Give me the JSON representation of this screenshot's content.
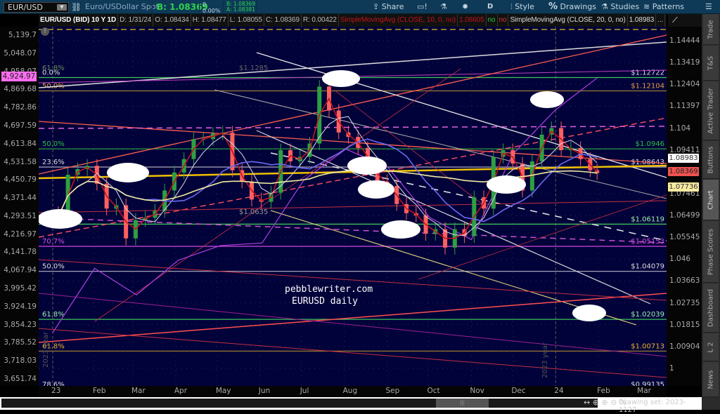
{
  "toolbar": {
    "symbol": "EUR/USD",
    "description": "Euro/USDollar Spot",
    "bid": "B: 1.08369",
    "change": "0",
    "change_pct": "0.00%",
    "bid_small": "B: 1.08369",
    "ask_small": "A: 1.08381",
    "share": "Share",
    "aggregation": "D",
    "style": "Style",
    "drawings": "Drawings",
    "studies": "Studies",
    "patterns": "Patterns"
  },
  "info": {
    "title": "EUR/USD (BID) 10 Y 1D",
    "date": "D: 1/31/24",
    "open": "O: 1.08434",
    "high": "H: 1.08477",
    "low": "L: 1.08055",
    "close": "C: 1.08369",
    "range": "R: 0.00422",
    "sma10": "SimpleMovingAvg (CLOSE, 10, 0, no)",
    "sma10_val": "1.08605",
    "no1": "no",
    "no2": "no",
    "sma20": "SimpleMovingAvg (CLOSE, 20, 0, no)",
    "sma20_val": "1.08983",
    "more": "..."
  },
  "side_tabs": [
    "Trade",
    "T&S",
    "Active Trader",
    "Buttons",
    "Chart",
    "Phase Scores",
    "Dashboard",
    "L 2",
    "News"
  ],
  "colors": {
    "bg": "#02023a",
    "up": "#2ea043",
    "down": "#ff5f5f",
    "sma10": "#c0141c",
    "sma20": "#d8d8e8",
    "sma50": "#6a6af0",
    "sma200": "#f0eaa0",
    "spx": "#b040e0"
  },
  "annotations": {
    "watermark": "pebblewriter.com",
    "subtitle": "EURUSD daily",
    "high_label": "$1.1285",
    "low_label": "$1.0635",
    "year_2023_a": "2023 year",
    "year_2023_b": "2023 year"
  },
  "price_tags": [
    {
      "value": "1.08983",
      "bg": "#ffffff",
      "fg": "#333"
    },
    {
      "value": "1.08369",
      "bg": "#ef5350",
      "fg": "#222"
    },
    {
      "value": "1.07736",
      "bg": "#f8eaa0",
      "fg": "#333"
    }
  ],
  "spx_tag": "4,924.97",
  "status": "Drawing set: 2023-1127",
  "chart_data": {
    "type": "candlestick",
    "title": "EUR/USD (BID) 10 Y 1D",
    "y_right_ticks": [
      1.14444,
      1.13419,
      1.12404,
      1.11397,
      1.104,
      1.09411,
      1.07461,
      1.06499,
      1.05545,
      1.046,
      1.03663,
      1.02735,
      1.01815,
      1.00904,
      1
    ],
    "y_right_labels": [
      "1.14444",
      "1.13419",
      "1.12404",
      "1.11397",
      "1.104",
      "1.09411",
      "1.07461",
      "1.06499",
      "1.05545",
      "1.046",
      "1.03663",
      "1.02735",
      "1.01815",
      "1.00904",
      "1"
    ],
    "y_right_range": [
      0.985,
      1.1555
    ],
    "y_left_ticks": [
      5139.7,
      5048.07,
      4958.07,
      4869.68,
      4782.86,
      4697.59,
      4613.84,
      4531.58,
      4450.79,
      4371.44,
      4293.51,
      4216.97,
      4141.78,
      4067.94,
      3995.42,
      3924.19,
      3854.23,
      3785.52,
      3718.03,
      3651.74
    ],
    "y_left_labels": [
      "5,139.7",
      "5,048.07",
      "4,958.07",
      "4,869.68",
      "4,782.86",
      "4,697.59",
      "4,613.84",
      "4,531.58",
      "4,450.79",
      "4,371.44",
      "4,293.51",
      "4,216.97",
      "4,141.78",
      "4,067.94",
      "3,995.42",
      "3,924.19",
      "3,854.23",
      "3,785.52",
      "3,718.03",
      "3,651.74"
    ],
    "x_labels": [
      {
        "t": "23",
        "day": 0
      },
      {
        "t": "Feb",
        "day": 30
      },
      {
        "t": "Mar",
        "day": 58
      },
      {
        "t": "Apr",
        "day": 89
      },
      {
        "t": "May",
        "day": 119
      },
      {
        "t": "Jun",
        "day": 150
      },
      {
        "t": "Jul",
        "day": 180
      },
      {
        "t": "Aug",
        "day": 211
      },
      {
        "t": "Sep",
        "day": 242
      },
      {
        "t": "Oct",
        "day": 272
      },
      {
        "t": "Nov",
        "day": 303
      },
      {
        "t": "Dec",
        "day": 333
      },
      {
        "t": "24",
        "day": 364
      },
      {
        "t": "Feb",
        "day": 395
      },
      {
        "t": "Mar",
        "day": 424
      }
    ],
    "eurusd_weekly_close": [
      1.0645,
      1.083,
      1.0855,
      1.087,
      1.079,
      1.068,
      1.0695,
      1.055,
      1.063,
      1.064,
      1.067,
      1.076,
      1.084,
      1.09,
      1.099,
      1.099,
      1.1015,
      1.102,
      1.085,
      1.08,
      1.072,
      1.071,
      1.075,
      1.094,
      1.089,
      1.091,
      1.097,
      1.123,
      1.112,
      1.102,
      1.1,
      1.095,
      1.087,
      1.08,
      1.078,
      1.07,
      1.066,
      1.065,
      1.057,
      1.059,
      1.051,
      1.059,
      1.056,
      1.073,
      1.068,
      1.091,
      1.094,
      1.088,
      1.076,
      1.089,
      1.101,
      1.104,
      1.094,
      1.095,
      1.09,
      1.085,
      1.08369
    ],
    "spx_monthly": [
      3824,
      4076,
      3970,
      4109,
      4169,
      4180,
      4450,
      4589,
      4508,
      4288,
      4194,
      4568,
      4770,
      4924.97
    ],
    "levels": [
      {
        "price": 1.12722,
        "label": "$1.12722",
        "fib": "0.0%",
        "color": "#3ec15a",
        "text": "#dddddd"
      },
      {
        "price": 1.12104,
        "label": "$1.12104",
        "fib": "50.0%",
        "color": "#9a7a30",
        "text": "#e8a040"
      },
      {
        "price": 1.0946,
        "label": "$1.0946",
        "fib": "50.0%",
        "color": "#2a9a3a",
        "text": "#2ec040"
      },
      {
        "price": 1.08643,
        "label": "$1.08643",
        "fib": "23.6%",
        "color": "#9a9ab0",
        "text": "#dddddd"
      },
      {
        "price": 1.06119,
        "label": "$1.06119",
        "fib": "",
        "color": "#3ec15a",
        "text": "#9ff0b0"
      },
      {
        "price": 1.05153,
        "label": "$1.05153",
        "fib": "70.7%",
        "color": "#c040d0",
        "text": "#d050e0"
      },
      {
        "price": 1.04079,
        "label": "$1.04079",
        "fib": "50.0%",
        "color": "#a0a0b8",
        "text": "#dddddd"
      },
      {
        "price": 1.02039,
        "label": "$1.02039",
        "fib": "61.8%",
        "color": "#3ec15a",
        "text": "#9ff0b0"
      },
      {
        "price": 1.00713,
        "label": "$1.00713",
        "fib": "61.8%",
        "color": "#9a7a30",
        "text": "#e8b030"
      },
      {
        "price": 0.99135,
        "label": "$0.99135",
        "fib": "78.6%",
        "color": "#9a2090",
        "text": "#dddddd"
      }
    ],
    "extra_fib": "61.8%"
  }
}
